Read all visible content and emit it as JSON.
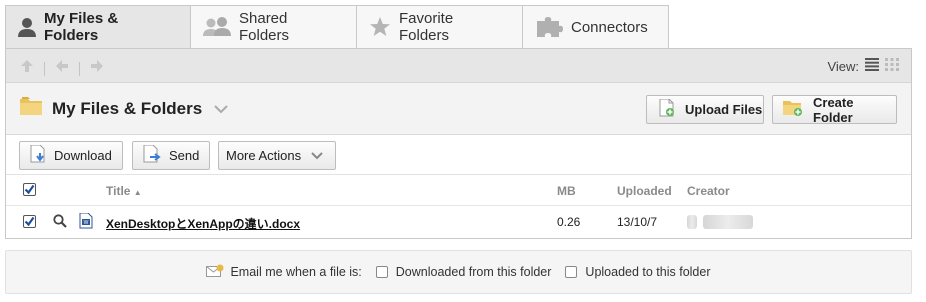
{
  "tabs": [
    {
      "label": "My Files & Folders",
      "icon": "user-icon",
      "active": true
    },
    {
      "label": "Shared Folders",
      "icon": "users-icon",
      "active": false
    },
    {
      "label": "Favorite Folders",
      "icon": "star-icon",
      "active": false
    },
    {
      "label": "Connectors",
      "icon": "puzzle-icon",
      "active": false
    }
  ],
  "navbar": {
    "view_label": "View:"
  },
  "folder": {
    "title": "My Files & Folders"
  },
  "buttons": {
    "upload": "Upload Files",
    "create": "Create Folder",
    "download": "Download",
    "send": "Send",
    "more": "More Actions"
  },
  "table": {
    "columns": {
      "title": "Title",
      "mb": "MB",
      "uploaded": "Uploaded",
      "creator": "Creator"
    },
    "rows": [
      {
        "title": "XenDesktopとXenAppの違い.docx",
        "mb": "0.26",
        "uploaded": "13/10/7",
        "checked": true
      }
    ]
  },
  "email": {
    "label": "Email me when a file is:",
    "option_downloaded": "Downloaded from this folder",
    "option_uploaded": "Uploaded to this folder"
  },
  "colors": {
    "tab_active_bg": "#e6e6e6",
    "navbar_bg": "#e6e6e6",
    "titlebar_bg": "#f3f3f3",
    "folder_icon": "#e8c35c"
  }
}
